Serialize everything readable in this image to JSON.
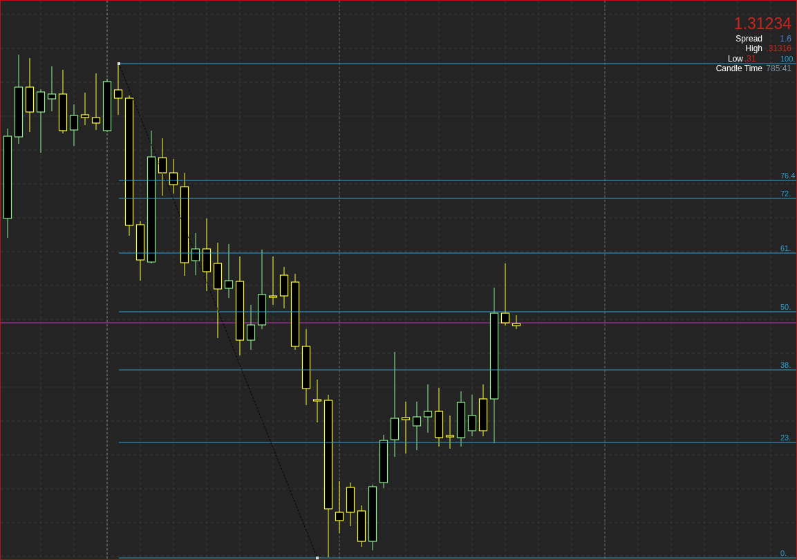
{
  "quote": {
    "price": "1.31234"
  },
  "info": [
    {
      "label": "Spread",
      "value": "1.6",
      "kind": "spread"
    },
    {
      "label": "High",
      "value": ".31316",
      "kind": "high"
    },
    {
      "label": "Low",
      "value": ".31",
      "kind": "low"
    },
    {
      "label": "Candle Time",
      "value": "785:41",
      "kind": "time"
    }
  ],
  "fib_levels": [
    {
      "label": "100."
    },
    {
      "label": "76.4"
    },
    {
      "label": "72."
    },
    {
      "label": "61."
    },
    {
      "label": "50."
    },
    {
      "label": "38."
    },
    {
      "label": "23."
    },
    {
      "label": "0."
    }
  ]
}
